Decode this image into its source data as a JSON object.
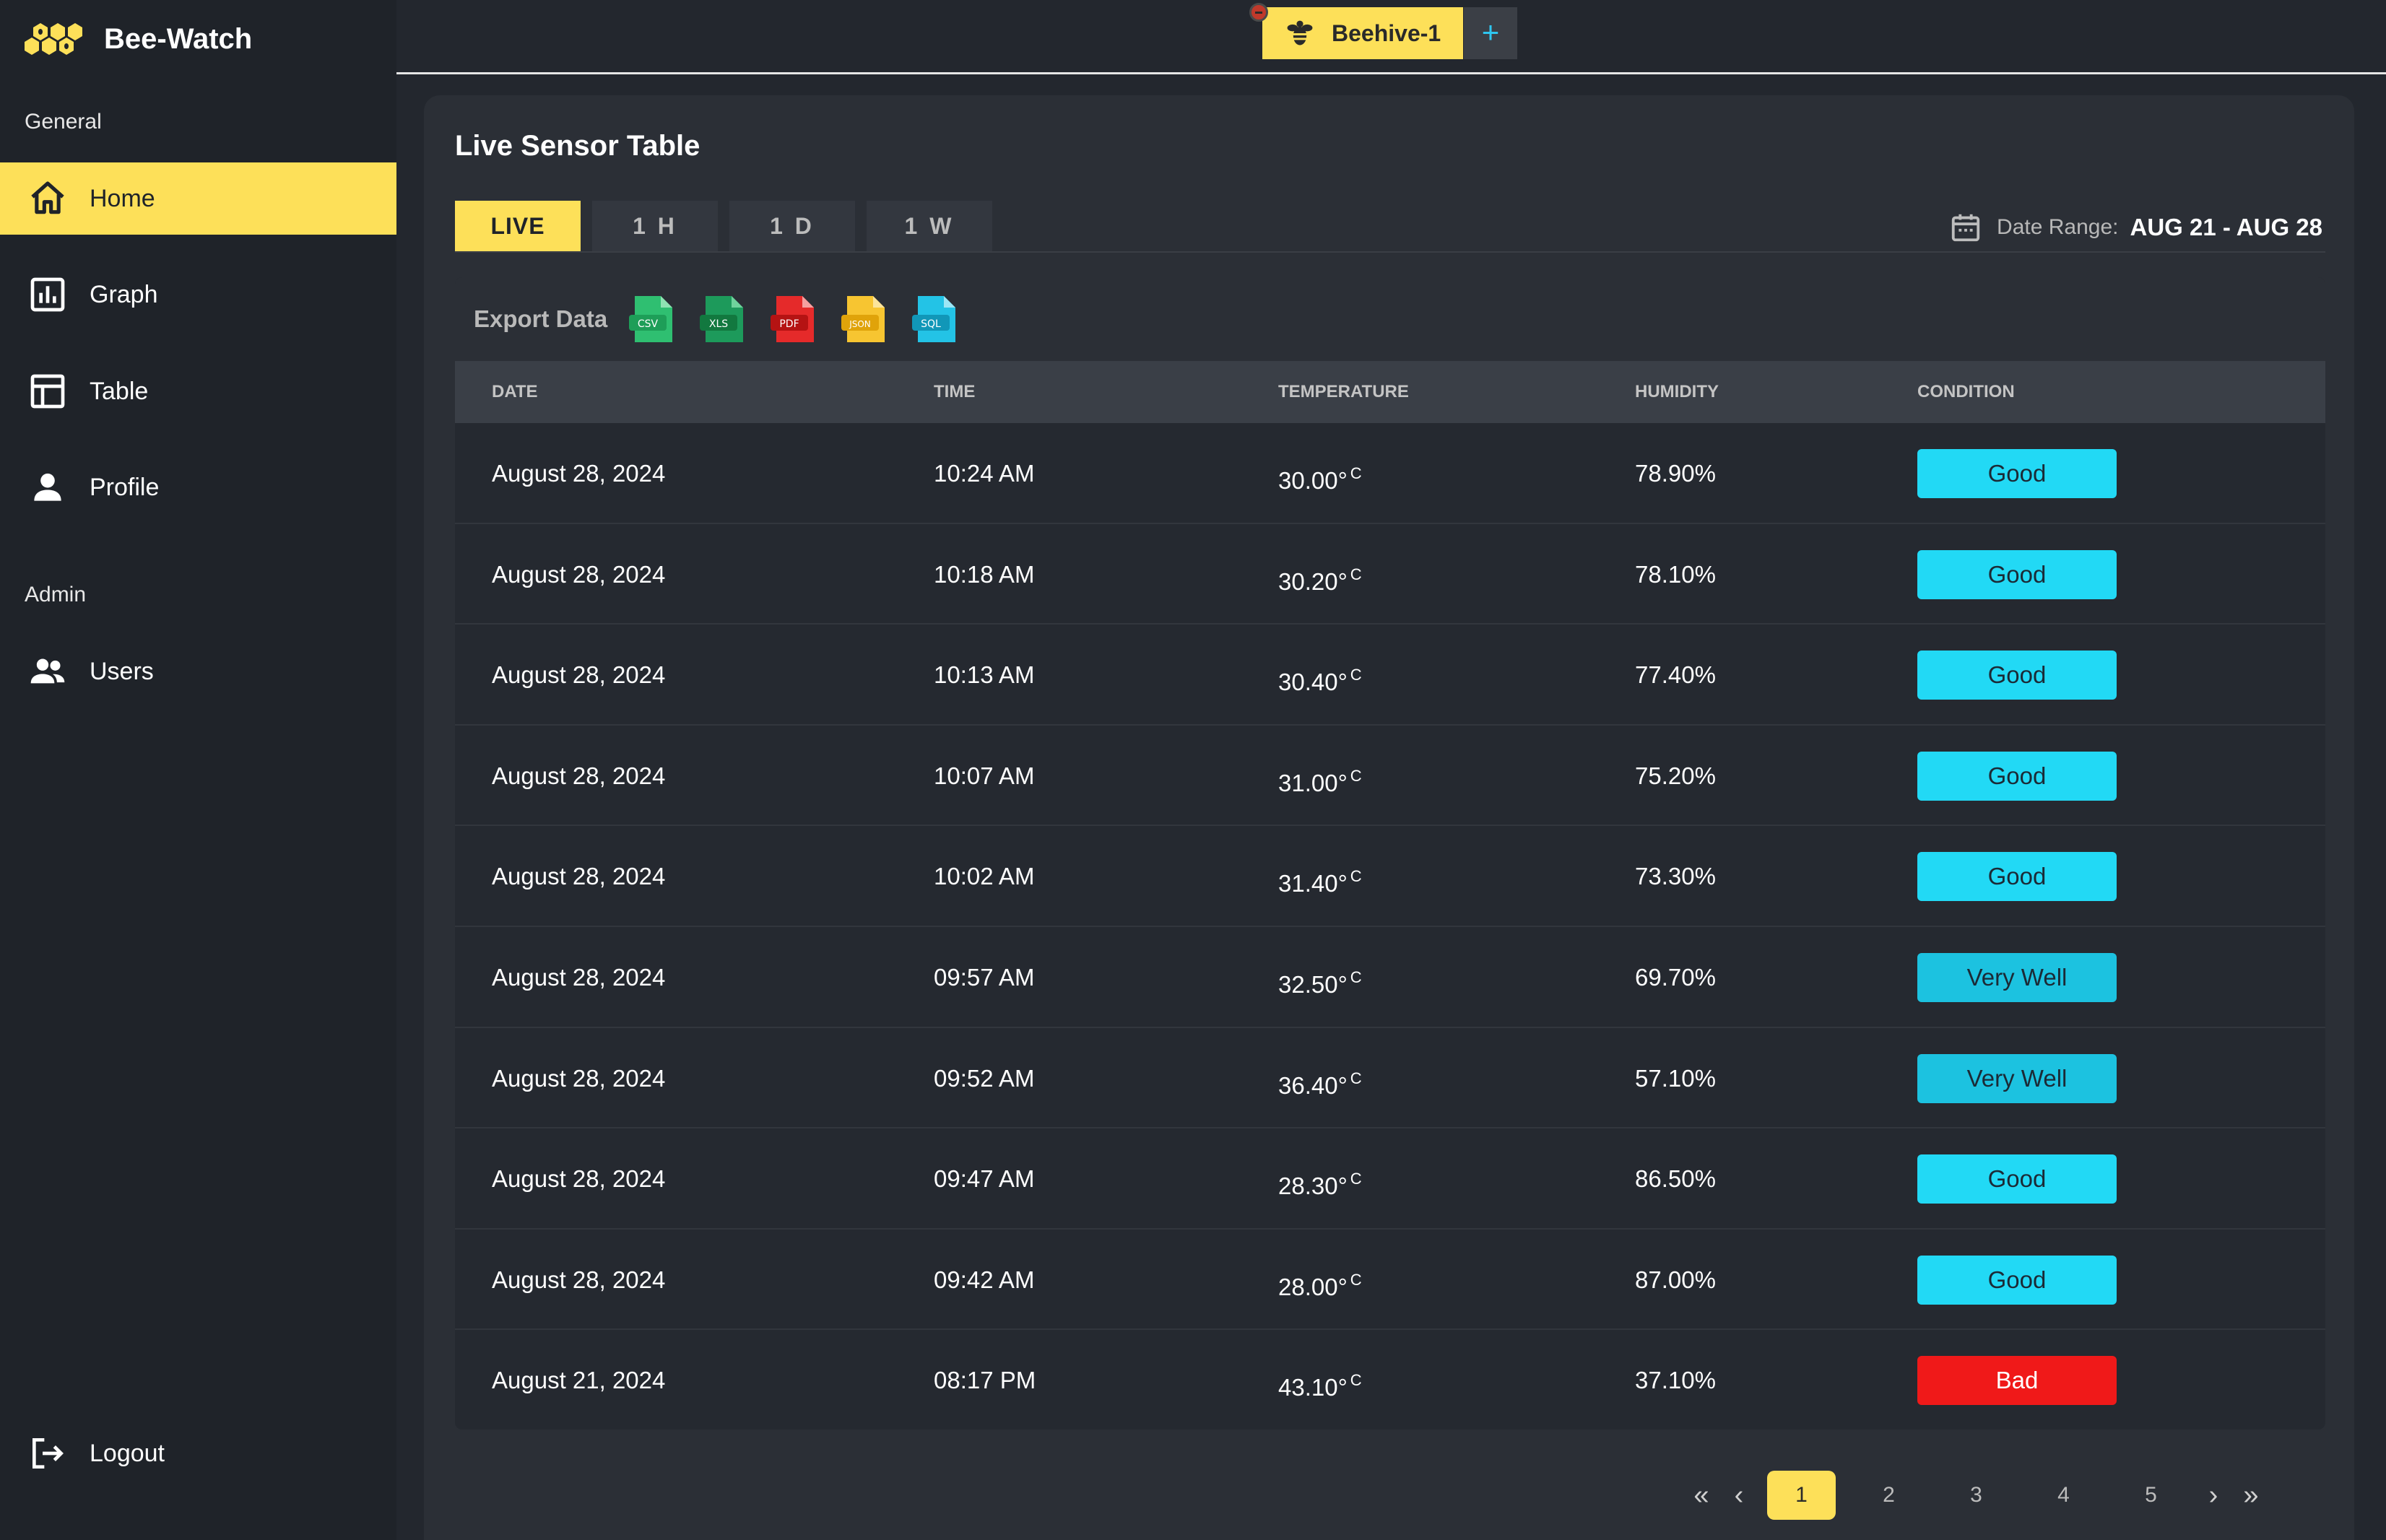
{
  "app": {
    "name": "Bee-Watch"
  },
  "sidebar": {
    "general_label": "General",
    "admin_label": "Admin",
    "items": [
      {
        "label": "Home",
        "icon": "home-icon",
        "active": true
      },
      {
        "label": "Graph",
        "icon": "chart-icon",
        "active": false
      },
      {
        "label": "Table",
        "icon": "table-icon",
        "active": false
      },
      {
        "label": "Profile",
        "icon": "person-icon",
        "active": false
      }
    ],
    "admin_items": [
      {
        "label": "Users",
        "icon": "users-icon"
      }
    ],
    "logout_label": "Logout"
  },
  "topbar": {
    "hive_tab": "Beehive-1",
    "add_tab": "+"
  },
  "main": {
    "title": "Live Sensor Table",
    "range_tabs": [
      "LIVE",
      "1 H",
      "1 D",
      "1 W"
    ],
    "active_range": "LIVE",
    "date_range_label": "Date Range:",
    "date_range_value": "AUG 21 - AUG 28",
    "export_label": "Export Data",
    "export_formats": [
      "CSV",
      "XLS",
      "PDF",
      "JSON",
      "SQL"
    ],
    "columns": [
      "DATE",
      "TIME",
      "TEMPERATURE",
      "HUMIDITY",
      "CONDITION"
    ],
    "unit": "C",
    "rows": [
      {
        "date": "August 28, 2024",
        "time": "10:24 AM",
        "temp": "30.00°",
        "humidity": "78.90%",
        "condition": "Good"
      },
      {
        "date": "August 28, 2024",
        "time": "10:18 AM",
        "temp": "30.20°",
        "humidity": "78.10%",
        "condition": "Good"
      },
      {
        "date": "August 28, 2024",
        "time": "10:13 AM",
        "temp": "30.40°",
        "humidity": "77.40%",
        "condition": "Good"
      },
      {
        "date": "August 28, 2024",
        "time": "10:07 AM",
        "temp": "31.00°",
        "humidity": "75.20%",
        "condition": "Good"
      },
      {
        "date": "August 28, 2024",
        "time": "10:02 AM",
        "temp": "31.40°",
        "humidity": "73.30%",
        "condition": "Good"
      },
      {
        "date": "August 28, 2024",
        "time": "09:57 AM",
        "temp": "32.50°",
        "humidity": "69.70%",
        "condition": "Very Well"
      },
      {
        "date": "August 28, 2024",
        "time": "09:52 AM",
        "temp": "36.40°",
        "humidity": "57.10%",
        "condition": "Very Well"
      },
      {
        "date": "August 28, 2024",
        "time": "09:47 AM",
        "temp": "28.30°",
        "humidity": "86.50%",
        "condition": "Good"
      },
      {
        "date": "August 28, 2024",
        "time": "09:42 AM",
        "temp": "28.00°",
        "humidity": "87.00%",
        "condition": "Good"
      },
      {
        "date": "August 21, 2024",
        "time": "08:17 PM",
        "temp": "43.10°",
        "humidity": "37.10%",
        "condition": "Bad"
      }
    ]
  },
  "pagination": {
    "first": "«",
    "prev": "‹",
    "next": "›",
    "last": "»",
    "pages": [
      "1",
      "2",
      "3",
      "4",
      "5"
    ],
    "current": "1"
  },
  "colors": {
    "accent": "#fde059",
    "good": "#22d9f5",
    "very_well": "#1cc2e0",
    "bad": "#f01919",
    "sidebar_bg": "#1f2329",
    "card_bg": "#2b2f36"
  }
}
